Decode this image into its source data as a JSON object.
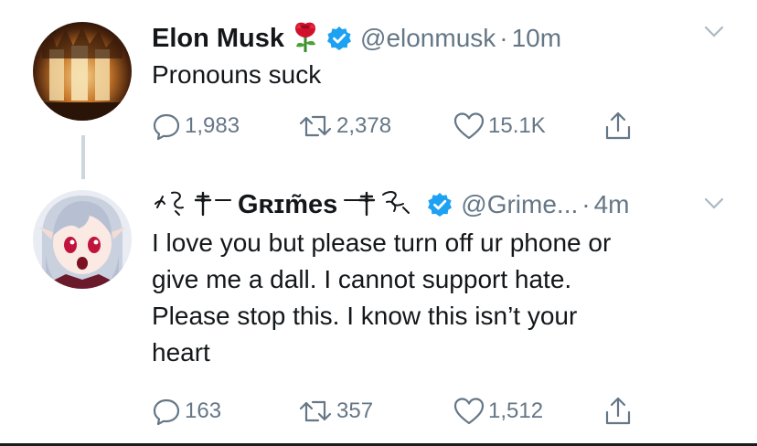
{
  "tweets": [
    {
      "display_name": "Elon Musk",
      "name_emoji": "rose-emoji",
      "verified": true,
      "handle": "@elonmusk",
      "separator": "·",
      "time": "10m",
      "text": "Pronouns suck",
      "replies": "1,983",
      "retweets": "2,378",
      "likes": "15.1K",
      "avatar_icon": "flaming-figures-avatar"
    },
    {
      "display_name": "Gʀɪm̃es",
      "name_prefix": "·̨͓̼ 𝕊 ✝",
      "name_suffix": "✝ 𝕊 ·",
      "verified": true,
      "handle": "@Grime...",
      "separator": "·",
      "time": "4m",
      "text_lines": [
        "I love you but please turn off ur phone or",
        "give me a dall.  I cannot support hate.",
        "Please stop this. I know this isn’t your",
        "heart"
      ],
      "replies": "163",
      "retweets": "357",
      "likes": "1,512",
      "avatar_icon": "anime-girl-avatar"
    }
  ],
  "colors": {
    "text": "#14171a",
    "secondary": "#657786",
    "verified": "#1da1f2",
    "thread_line": "#ccd6dd"
  }
}
